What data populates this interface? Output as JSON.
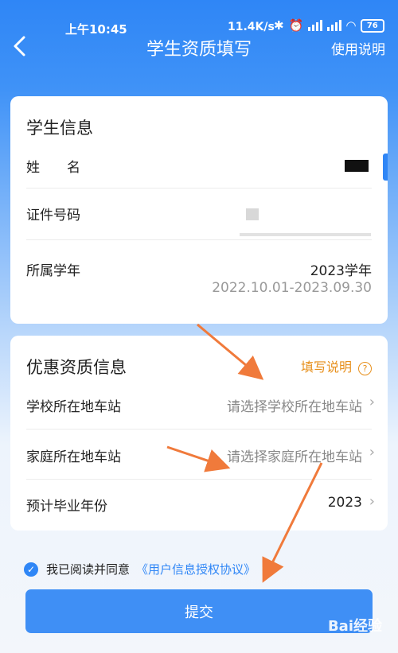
{
  "status": {
    "time": "上午10:45",
    "network_speed": "11.4K/s",
    "battery": "76"
  },
  "nav": {
    "title": "学生资质填写",
    "help": "使用说明",
    "back_icon": "chevron-left-icon"
  },
  "student_info": {
    "title": "学生信息",
    "name_label": "姓　　名",
    "id_label": "证件号码",
    "year_label": "所属学年",
    "year_value": "2023学年",
    "year_range": "2022.10.01-2023.09.30"
  },
  "discount_info": {
    "title": "优惠资质信息",
    "fill_note": "填写说明",
    "help_icon": "question-circle-icon",
    "school_station_label": "学校所在地车站",
    "school_station_placeholder": "请选择学校所在地车站",
    "home_station_label": "家庭所在地车站",
    "home_station_placeholder": "请选择家庭所在地车站",
    "graduation_label": "预计毕业年份",
    "graduation_value": "2023"
  },
  "agreement": {
    "prefix": "我已阅读并同意",
    "link": "《用户信息授权协议》",
    "checked": true
  },
  "submit_label": "提交",
  "watermark": "Bai经验",
  "colors": {
    "primary": "#2f86f6",
    "accent_orange": "#e7901d",
    "annotation_arrow": "#f07a3b"
  }
}
